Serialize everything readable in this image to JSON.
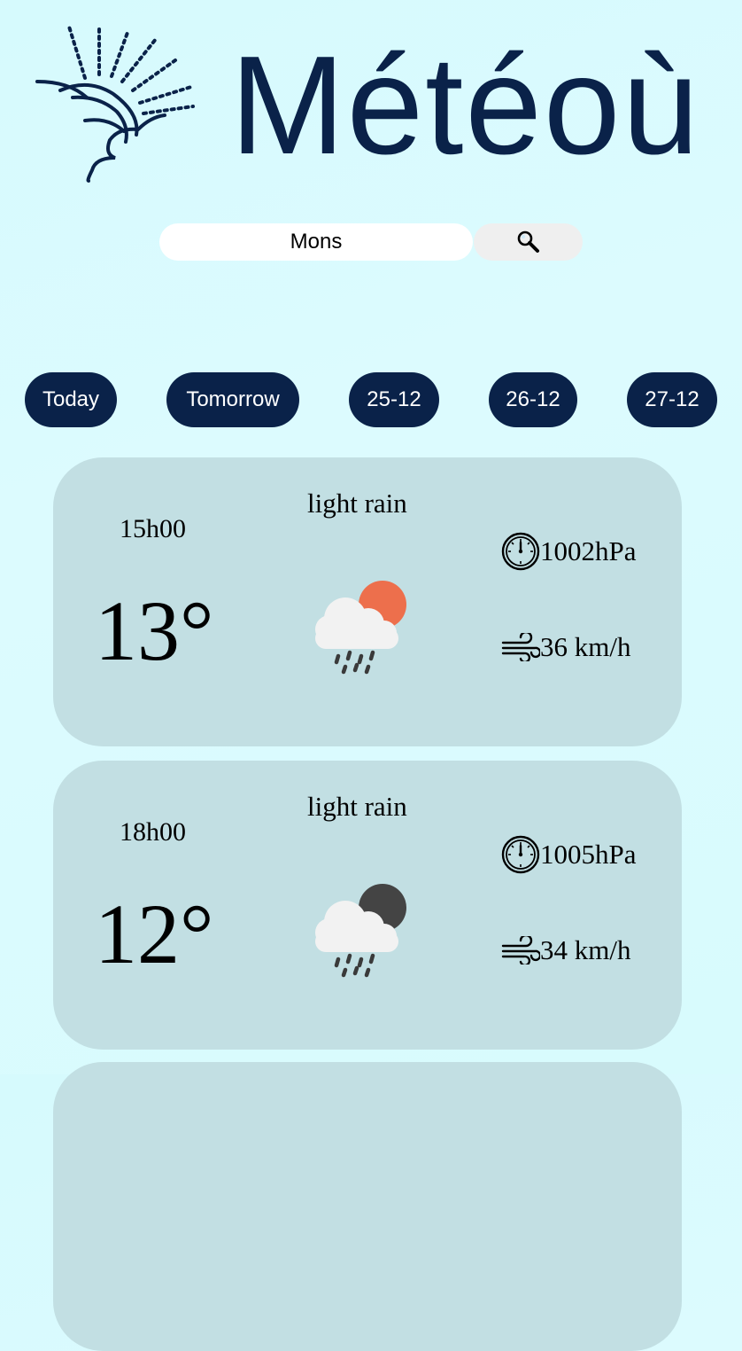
{
  "app": {
    "title": "Météoù"
  },
  "search": {
    "value": "Mons"
  },
  "tabs": [
    {
      "label": "Today"
    },
    {
      "label": "Tomorrow"
    },
    {
      "label": "25-12"
    },
    {
      "label": "26-12"
    },
    {
      "label": "27-12"
    }
  ],
  "forecast": [
    {
      "time": "15h00",
      "temperature": "13°",
      "description": "light rain",
      "pressure": "1002hPa",
      "wind": "36 km/h",
      "icon": "rain-cloud-sun-icon"
    },
    {
      "time": "18h00",
      "temperature": "12°",
      "description": "light rain",
      "pressure": "1005hPa",
      "wind": "34 km/h",
      "icon": "rain-cloud-moon-icon"
    }
  ],
  "colors": {
    "brand": "#0a2249",
    "background": "#d8fbfd",
    "card": "#c2dfe3",
    "sun": "#ed6f4c",
    "moon": "#444444"
  }
}
